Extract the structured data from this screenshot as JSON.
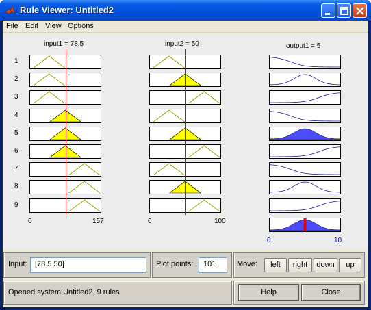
{
  "window": {
    "title": "Rule Viewer: Untitled2",
    "buttons": [
      "minimize",
      "maximize",
      "close"
    ]
  },
  "menu": [
    "File",
    "Edit",
    "View",
    "Options"
  ],
  "plots": {
    "input1_title": "input1 = 78.5",
    "input2_title": "input2 = 50",
    "output1_title": "output1 = 5",
    "rule_numbers": [
      "1",
      "2",
      "3",
      "4",
      "5",
      "6",
      "7",
      "8",
      "9"
    ],
    "input1_axis": [
      "0",
      "157"
    ],
    "input2_axis": [
      "0",
      "100"
    ],
    "output1_axis": [
      "0",
      "10"
    ],
    "input1_value": 78.5,
    "input1_range": [
      0,
      157
    ],
    "input2_value": 50,
    "input2_range": [
      0,
      100
    ],
    "output1_value": 5,
    "output1_range": [
      0,
      10
    ]
  },
  "controls": {
    "input_label": "Input:",
    "input_value": "[78.5 50]",
    "plot_points_label": "Plot points:",
    "plot_points_value": "101",
    "move_label": "Move:",
    "move_buttons": [
      "left",
      "right",
      "down",
      "up"
    ],
    "status": "Opened system Untitled2, 9 rules",
    "help_button": "Help",
    "close_button": "Close"
  },
  "colors": {
    "fired_fill": "#ffff00",
    "output_fill": "#4c4cff",
    "marker": "#e00000",
    "mf_line": "#a0a000"
  }
}
